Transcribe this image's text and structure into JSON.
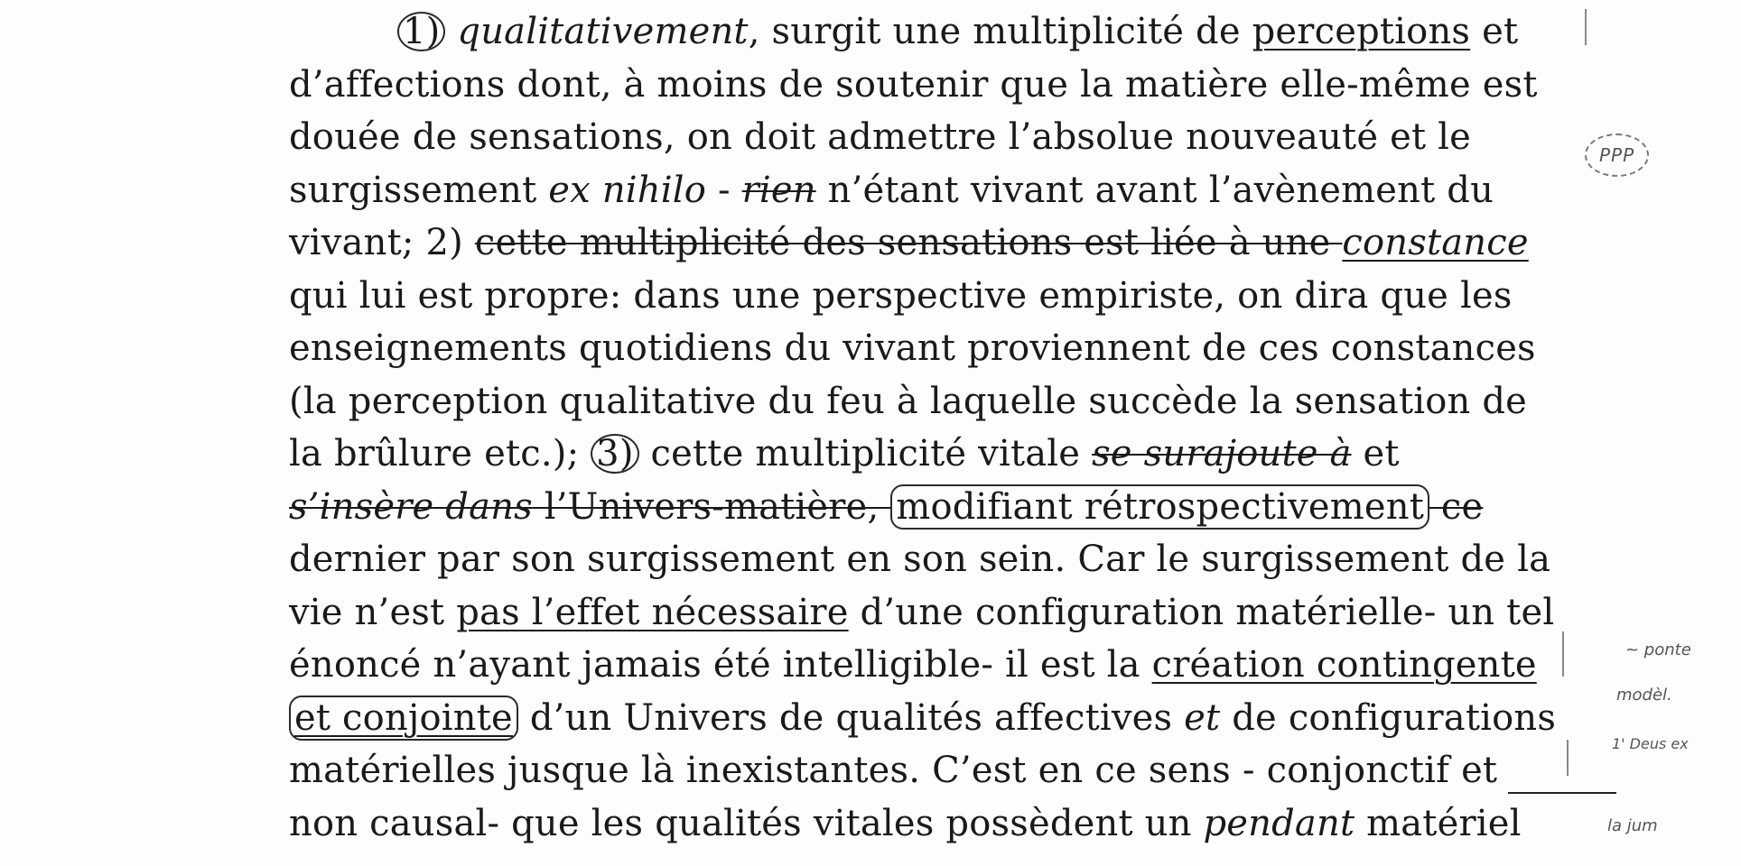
{
  "document": {
    "lines": [
      {
        "parts": [
          "1)",
          " qualitativement",
          ", surgit une multiplicité de ",
          "perceptions",
          " et"
        ]
      },
      {
        "text": "d’affections dont, à moins de soutenir que la matière elle-même est"
      },
      {
        "text": "douée de sensations, on doit admettre l’absolue nouveauté et le"
      },
      {
        "parts": [
          "surgissement ",
          "ex nihilo",
          " - ",
          "rien",
          " n’étant vivant avant l’avènement du"
        ]
      },
      {
        "parts": [
          "vivant; 2) ",
          "cette multiplicité des sensations est liée à une ",
          "constance"
        ]
      },
      {
        "text": "qui lui est propre: dans une perspective empiriste, on dira que les"
      },
      {
        "text": "enseignements quotidiens du vivant proviennent de ces constances"
      },
      {
        "text": "(la perception qualitative du feu à laquelle succède la sensation de"
      },
      {
        "parts": [
          "la brûlure etc.); ",
          "3)",
          " cette multiplicité vitale ",
          "se surajoute à",
          "  et"
        ]
      },
      {
        "parts": [
          "s’insère dans",
          "  l’Univers-matière, ",
          "modifiant rétrospectivement",
          " ce"
        ]
      },
      {
        "text": "dernier par son surgissement en son sein. Car le surgissement de la"
      },
      {
        "parts": [
          "vie n’est ",
          "pas l’effet nécessaire",
          " d’une configuration matérielle- un tel"
        ]
      },
      {
        "parts": [
          "énoncé n’ayant jamais été intelligible- il est la ",
          "création contingente"
        ]
      },
      {
        "parts": [
          "et conjointe",
          " d’un Univers de qualités affectives ",
          "et",
          "  de configurations"
        ]
      },
      {
        "text": "matérielles jusque là inexistantes. C’est en ce sens - conjonctif et"
      },
      {
        "parts": [
          "non causal- que les qualités vitales possèdent un ",
          "pendant",
          " matériel"
        ]
      }
    ]
  },
  "margin_notes": {
    "ppp": "PPP",
    "note1": "~ ponte",
    "note2": "modèl.",
    "note3": "1' Deus ex",
    "note4": "la jum"
  }
}
